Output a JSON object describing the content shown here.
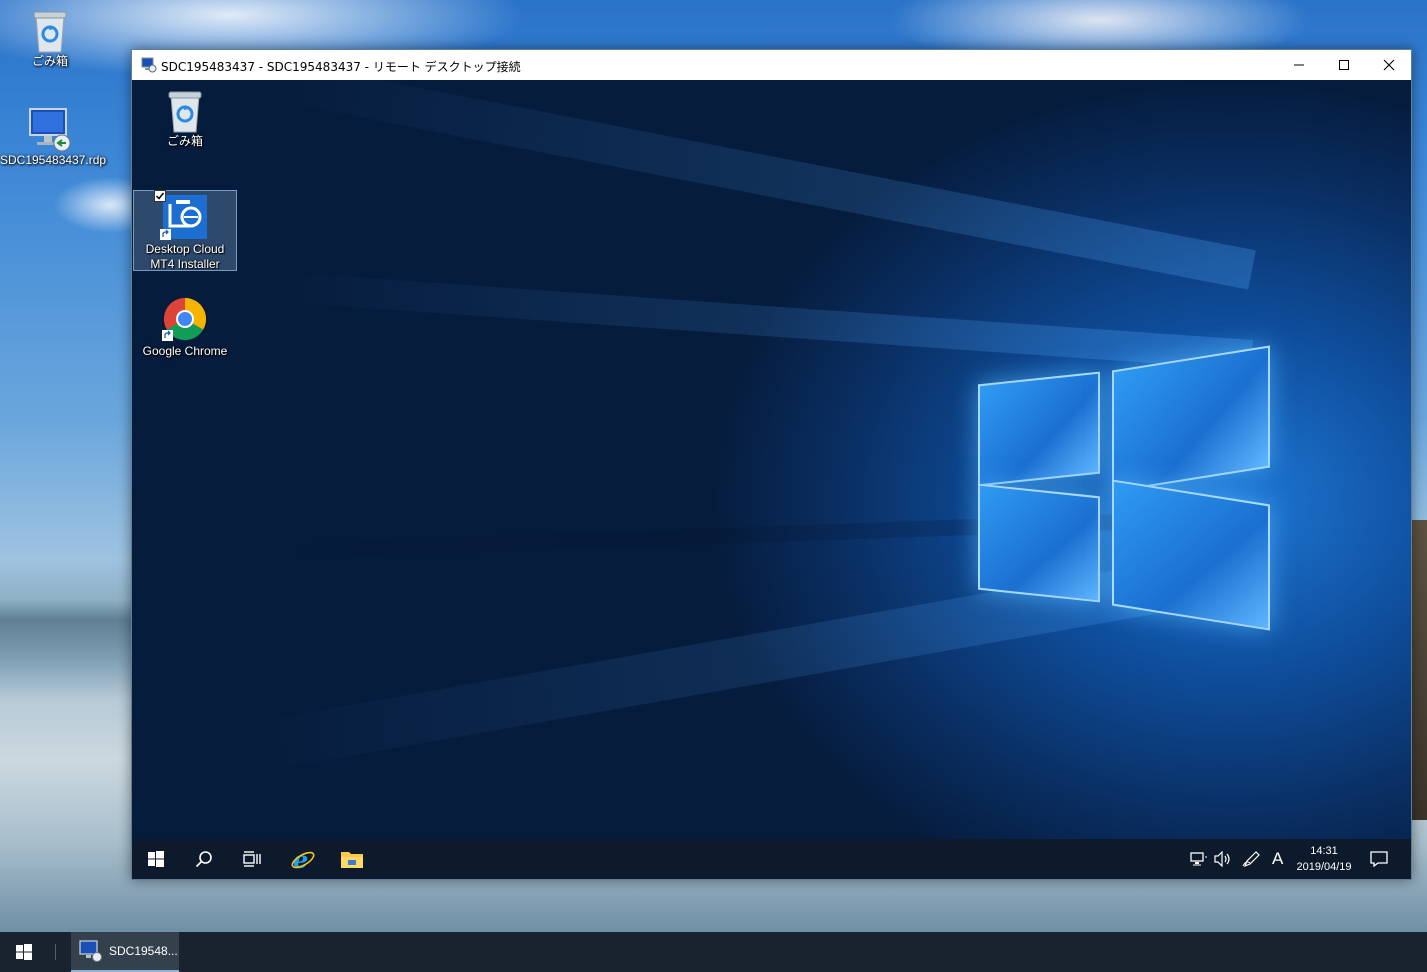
{
  "host_desktop": {
    "icons": [
      {
        "label": "ごみ箱",
        "icon": "recycle-bin-icon"
      },
      {
        "label": "SDC195483437.rdp",
        "icon": "remote-desktop-file-icon"
      }
    ]
  },
  "rdp_window": {
    "title": "SDC195483437 - SDC195483437 - リモート デスクトップ接続",
    "icon": "remote-desktop-icon",
    "controls": {
      "minimize": "minimize-icon",
      "maximize": "maximize-icon",
      "close": "close-icon"
    }
  },
  "remote_desktop": {
    "icons": [
      {
        "label": "ごみ箱",
        "icon": "recycle-bin-icon",
        "selected": false
      },
      {
        "label_line1": "Desktop Cloud",
        "label_line2": "MT4 Installer",
        "icon": "installer-shortcut-icon",
        "selected": true,
        "checked": true
      },
      {
        "label": "Google Chrome",
        "icon": "chrome-icon",
        "selected": false
      }
    ],
    "taskbar": {
      "items": [
        "start-icon",
        "search-icon",
        "task-view-icon",
        "internet-explorer-icon",
        "file-explorer-icon"
      ],
      "tray": {
        "network": "network-icon",
        "volume": "volume-icon",
        "pen": "pen-icon",
        "ime": "A",
        "time": "14:31",
        "date": "2019/04/19",
        "notifications": "action-center-icon"
      }
    }
  },
  "host_taskbar": {
    "start": "start-icon",
    "app_label": "SDC19548...",
    "app_icon": "remote-desktop-icon",
    "accent": "#8fb3d6"
  }
}
